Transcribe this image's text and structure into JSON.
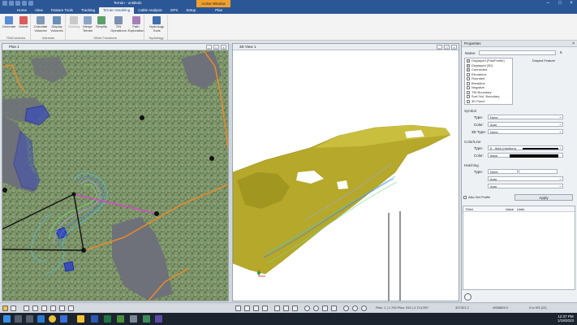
{
  "app": {
    "title": "Terrain - untitled1",
    "active_window_label": "Active Window",
    "context_tab": "Plan"
  },
  "menu_tabs": [
    "Home",
    "View",
    "Feature Tools",
    "Tracking",
    "Terrain Modeling",
    "Cable Analysis",
    "GPS",
    "Setup"
  ],
  "active_tab": "Terrain Modeling",
  "ribbon": {
    "groups": [
      {
        "label": "TIN/Contours",
        "buttons": [
          {
            "label": "Generate",
            "disabled": false
          },
          {
            "label": "Delete",
            "disabled": false
          }
        ]
      },
      {
        "label": "Volumes",
        "buttons": [
          {
            "label": "Calculate Volumes",
            "disabled": false
          },
          {
            "label": "Display Volumes",
            "disabled": false
          }
        ]
      },
      {
        "label": "Other Functions",
        "buttons": [
          {
            "label": "Grading",
            "disabled": true
          },
          {
            "label": "Merge Terrain",
            "disabled": false
          },
          {
            "label": "Simplify",
            "disabled": false
          },
          {
            "label": "TIN Operations",
            "disabled": false
          },
          {
            "label": "Path Exploration",
            "disabled": false
          }
        ]
      },
      {
        "label": "Hydrology",
        "buttons": [
          {
            "label": "Hydrology Tools",
            "disabled": false
          }
        ]
      }
    ]
  },
  "plan_pane": {
    "title": "Plan 1"
  },
  "view3d_pane": {
    "title": "3D View 1"
  },
  "properties": {
    "title": "Properties",
    "name_label": "Name:",
    "name_value": "",
    "draped_label": "Draped Feature",
    "spin_value": "5",
    "layers": [
      {
        "label": "Displayed (PlanProfile)",
        "checked": true
      },
      {
        "label": "Displayed (3D)",
        "checked": true
      },
      {
        "label": "Connected",
        "checked": true
      },
      {
        "label": "Elevations",
        "checked": false
      },
      {
        "label": "Rounded",
        "checked": false
      },
      {
        "label": "Breakline",
        "checked": false
      },
      {
        "label": "Negative",
        "checked": false
      },
      {
        "label": "TIN Boundary",
        "checked": false
      },
      {
        "label": "Surf./Vol. Boundary",
        "checked": false
      },
      {
        "label": "3D Panel",
        "checked": false
      }
    ],
    "symbol": {
      "section": "Symbol",
      "type_label": "Type:",
      "type_value": "None",
      "color_label": "Color:",
      "color_value": "Auto",
      "type3d_label": "3D Type:",
      "type3d_value": "None"
    },
    "colorline": {
      "section": "Color/Line",
      "type_label": "Type:",
      "type_value": "5 - thick (medium)",
      "color_label": "Color:",
      "color_value": "black"
    },
    "hatching": {
      "section": "Hatching",
      "type_label": "Type:",
      "type_value": "None",
      "row2_value": "Auto",
      "row3_value": "Auto"
    },
    "also_set_profile_label": "Also Set Profile",
    "apply_label": "Apply",
    "table_headers": [
      "Field",
      "Value",
      "Units"
    ]
  },
  "statusbar": {
    "pos": "Plan: 1 | 1,700 Plan: 910 | 2,713,397",
    "coord1": "327321.2",
    "coord2": "4906803.0",
    "coord3": "0 to 9/3 (22)"
  },
  "taskbar": {
    "time": "12:37 PM",
    "date": "1/19/2023"
  },
  "colors": {
    "titlebar": "#2b5797",
    "accent": "#f0a030",
    "terrain": "#b5a82a",
    "boundary": "#e98a2a",
    "water": "#6e7179"
  }
}
